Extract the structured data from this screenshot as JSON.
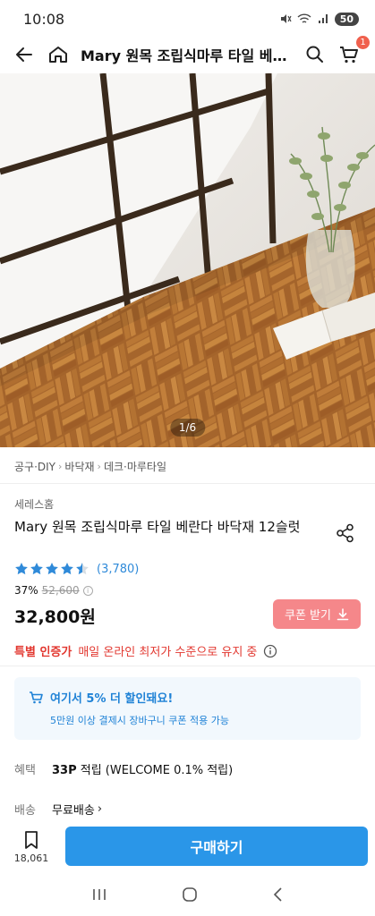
{
  "status_bar": {
    "time": "10:08",
    "battery": "50"
  },
  "nav": {
    "title": "Mary 원목 조립식마루 타일 베…",
    "cart_count": "1"
  },
  "hero": {
    "counter": "1/6"
  },
  "breadcrumb": [
    "공구·DIY",
    "바닥재",
    "데크·마루타일"
  ],
  "product": {
    "brand": "세레스홈",
    "title": "Mary 원목 조립식마루 타일 베란다 바닥재 12슬럿",
    "rating": 4.5,
    "review_count": "(3,780)",
    "discount": "37%",
    "original_price": "52,600",
    "sale_price": "32,800원"
  },
  "coupon": {
    "label": "쿠폰 받기"
  },
  "certified": {
    "label": "특별 인증가",
    "desc": "매일 온라인 최저가 수준으로 유지 중"
  },
  "promo": {
    "title": "여기서 5% 더 할인돼요!",
    "subtitle": "5만원 이상 결제시 장바구니 쿠폰 적용 가능"
  },
  "benefit": {
    "key": "혜택",
    "points": "33P",
    "text": " 적립 (WELCOME 0.1% 적립)"
  },
  "shipping": {
    "key": "배송",
    "value": "무료배송"
  },
  "bottom": {
    "wish_count": "18,061",
    "buy_label": "구매하기"
  },
  "colors": {
    "accent": "#2a96e8",
    "coupon": "#f5878a",
    "certified": "#e2372f",
    "star": "#2f8ad9"
  }
}
